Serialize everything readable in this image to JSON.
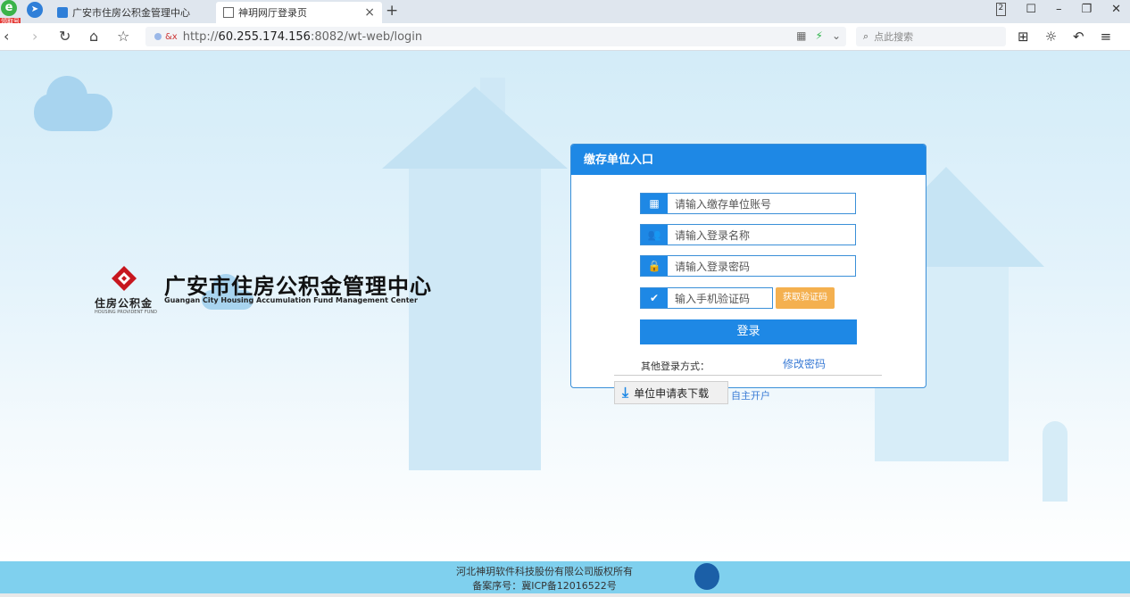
{
  "browser": {
    "tabs": [
      {
        "label": "广安市住房公积金管理中心"
      },
      {
        "label": "神玥网厅登录页"
      }
    ],
    "badge": "领取号",
    "url_prefix": "http://",
    "url_host": "60.255.174.156",
    "url_rest": ":8082/wt-web/login",
    "search_placeholder": "点此搜索"
  },
  "logo": {
    "title": "广安市住房公积金管理中心",
    "subtitle": "Guangan City Housing Accumulation Fund  Management Center",
    "small_cn": "住房公积金",
    "small_en": "HOUSING PROVIDENT FUND"
  },
  "login": {
    "heading": "缴存单位入口",
    "account_placeholder": "请输入缴存单位账号",
    "username_placeholder": "请输入登录名称",
    "password_placeholder": "请输入登录密码",
    "sms_placeholder": "输入手机验证码",
    "get_code": "获取验证码",
    "submit": "登录",
    "other_methods": "其他登录方式：",
    "change_password": "修改密码"
  },
  "below": {
    "download": "单位申请表下载",
    "self_open": "自主开户"
  },
  "footer": {
    "copyright": "河北神玥软件科技股份有限公司版权所有",
    "icp": "备案序号：冀ICP备12016522号"
  }
}
